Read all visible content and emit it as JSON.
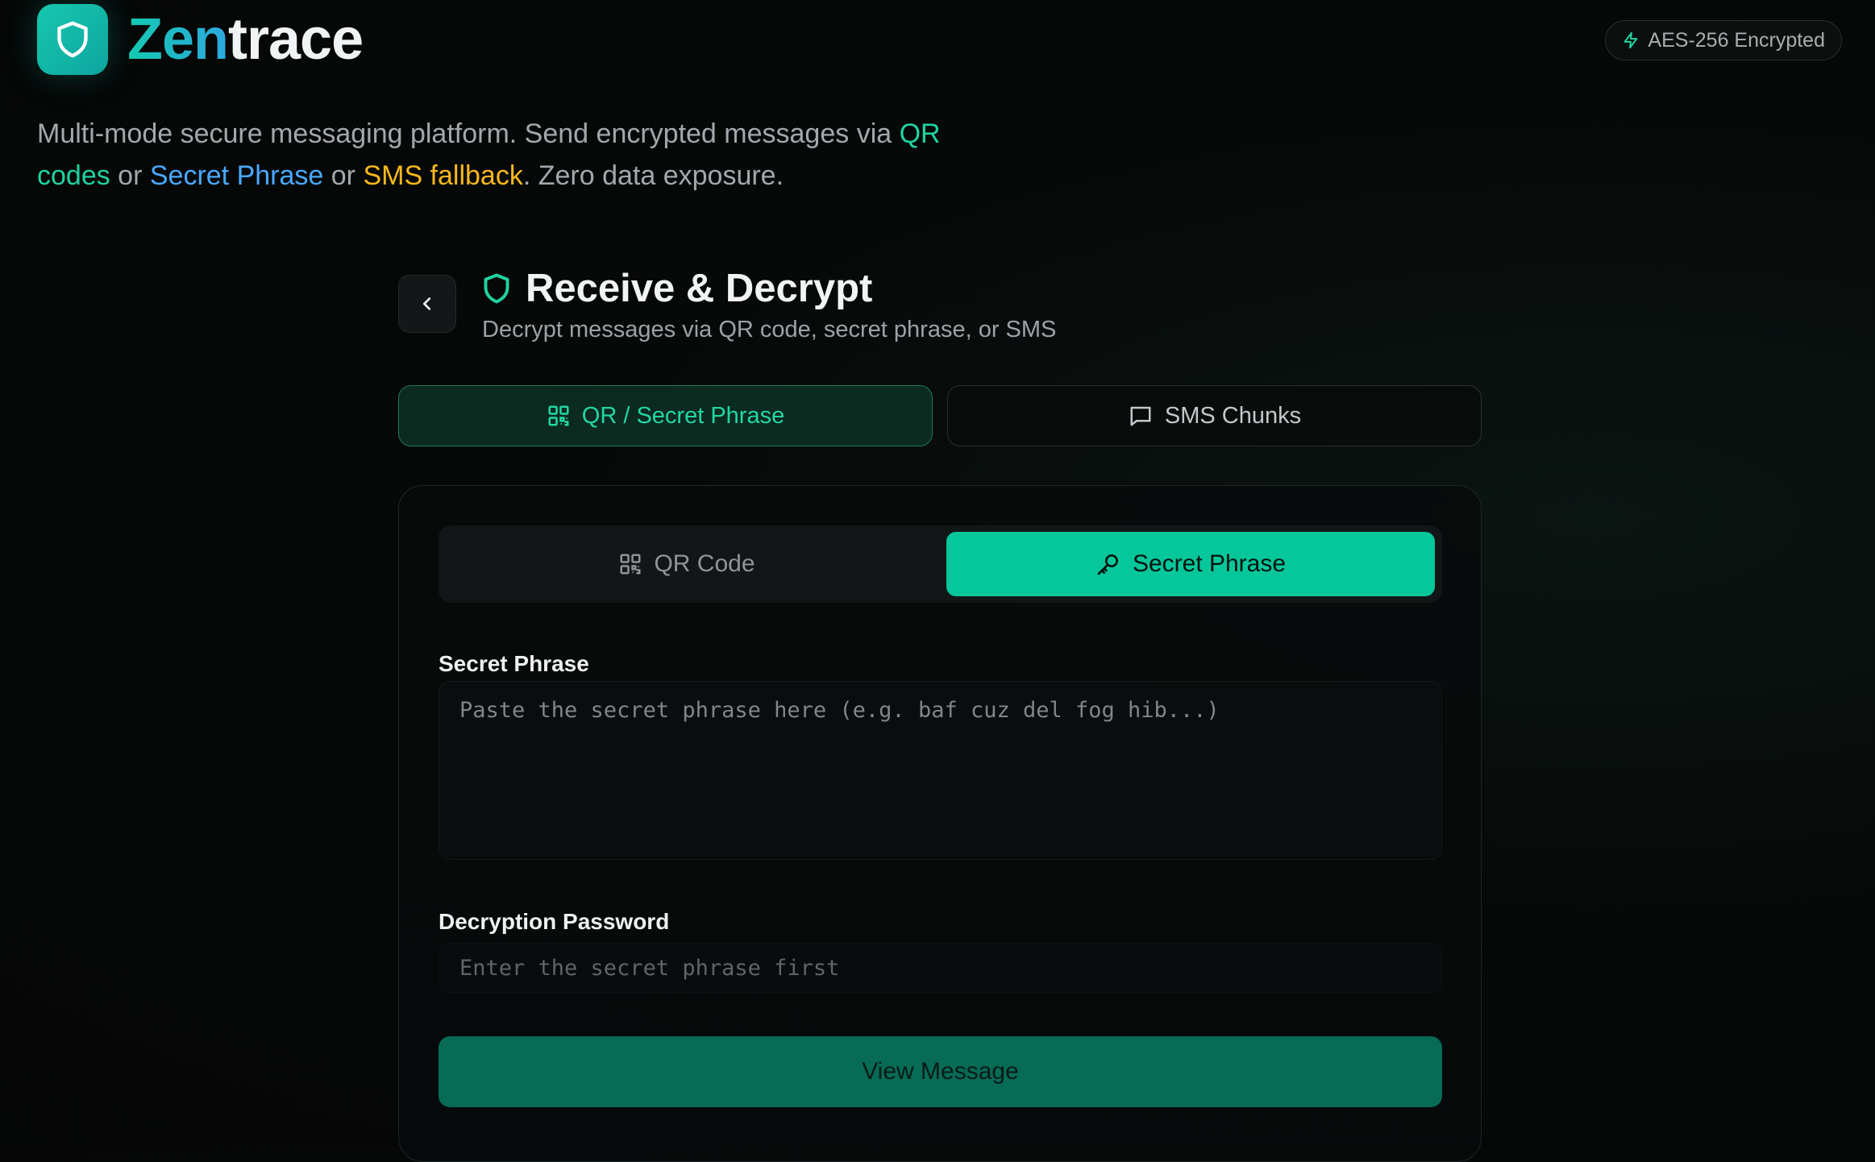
{
  "app": {
    "name_part1": "Zen",
    "name_part2": "trace"
  },
  "badge": {
    "label": "AES-256 Encrypted",
    "icon": "lightning-icon"
  },
  "tagline": {
    "prefix": "Multi-mode secure messaging platform. Send encrypted messages via ",
    "qr": "QR codes",
    "or1": " or ",
    "phrase": "Secret Phrase",
    "or2": " or ",
    "sms": "SMS fallback",
    "suffix": ". Zero data exposure."
  },
  "page": {
    "title": "Receive & Decrypt",
    "subtitle": "Decrypt messages via QR code, secret phrase, or SMS"
  },
  "main_tabs": [
    {
      "label": "QR / Secret Phrase",
      "icon": "qr-code-icon",
      "active": true
    },
    {
      "label": "SMS Chunks",
      "icon": "message-square-icon",
      "active": false
    }
  ],
  "sub_tabs": [
    {
      "label": "QR Code",
      "icon": "qr-code-icon",
      "active": false
    },
    {
      "label": "Secret Phrase",
      "icon": "key-icon",
      "active": true
    }
  ],
  "form": {
    "phrase_label": "Secret Phrase",
    "phrase_placeholder": "Paste the secret phrase here (e.g. baf cuz del fog hib...)",
    "password_label": "Decryption Password",
    "password_placeholder": "Enter the secret phrase first",
    "submit_label": "View Message"
  },
  "colors": {
    "accent": "#05c79b",
    "tagline_green": "#1ed3a2",
    "tagline_blue": "#4aa8ff",
    "tagline_yellow": "#f8b81d",
    "button": "#076b56"
  }
}
